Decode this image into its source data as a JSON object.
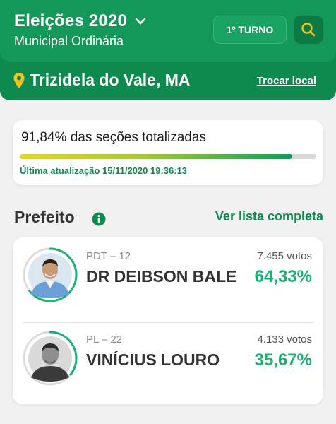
{
  "header": {
    "title": "Eleições 2020",
    "subtitle": "Municipal Ordinária",
    "turno_label": "1º TURNO",
    "location": "Trizidela do Vale, MA",
    "change_location_label": "Trocar local",
    "colors": {
      "primary": "#14985a",
      "dark": "#0f8a4f",
      "accent": "#f4c21a"
    }
  },
  "progress": {
    "title": "91,84% das seções totalizadas",
    "percent": 91.84,
    "last_update": "Última atualização 15/11/2020 19:36:13"
  },
  "section": {
    "title": "Prefeito",
    "info_icon": "info-icon",
    "see_full_list": "Ver lista completa"
  },
  "candidates": [
    {
      "party": "PDT – 12",
      "name": "DR DEIBSON BALE",
      "votes": "7.455 votos",
      "percent_label": "64,33%",
      "percent": 64.33
    },
    {
      "party": "PL – 22",
      "name": "VINÍCIUS LOURO",
      "votes": "4.133 votos",
      "percent_label": "35,67%",
      "percent": 35.67
    }
  ]
}
